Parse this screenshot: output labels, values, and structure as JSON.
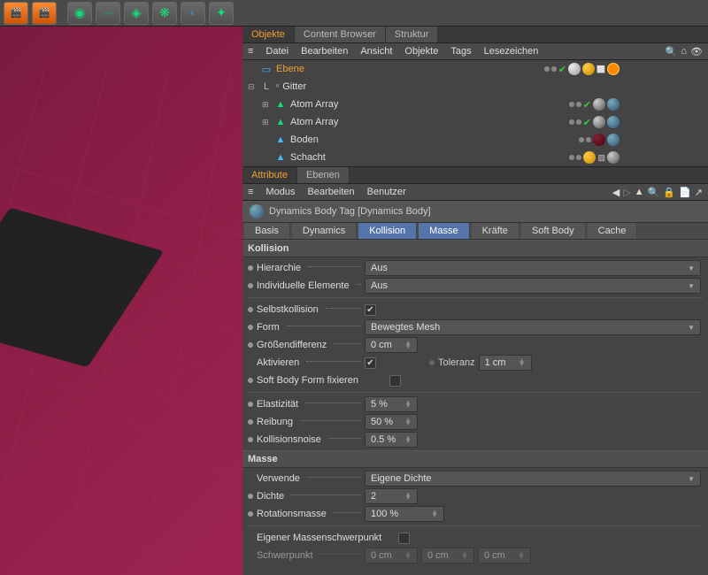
{
  "tabs": {
    "objects": "Objekte",
    "content_browser": "Content Browser",
    "struktur": "Struktur"
  },
  "menu": {
    "datei": "Datei",
    "bearbeiten": "Bearbeiten",
    "ansicht": "Ansicht",
    "objekte": "Objekte",
    "tags": "Tags",
    "lesezeichen": "Lesezeichen"
  },
  "tree": {
    "ebene": "Ebene",
    "gitter": "Gitter",
    "atom_array": "Atom Array",
    "boden": "Boden",
    "schacht": "Schacht"
  },
  "attr_tabs": {
    "attribute": "Attribute",
    "ebenen": "Ebenen"
  },
  "attr_menu": {
    "modus": "Modus",
    "bearbeiten": "Bearbeiten",
    "benutzer": "Benutzer"
  },
  "header": "Dynamics Body Tag [Dynamics Body]",
  "ptabs": {
    "basis": "Basis",
    "dynamics": "Dynamics",
    "kollision": "Kollision",
    "masse": "Masse",
    "kraefte": "Kräfte",
    "softbody": "Soft Body",
    "cache": "Cache"
  },
  "section": {
    "kollision": "Kollision",
    "masse": "Masse"
  },
  "labels": {
    "hierarchie": "Hierarchie",
    "indiv": "Individuelle Elemente",
    "selbst": "Selbstkollision",
    "form": "Form",
    "groesse": "Größendifferenz",
    "aktivieren": "Aktivieren",
    "toleranz": "Toleranz",
    "softbody": "Soft Body Form fixieren",
    "elast": "Elastizität",
    "reibung": "Reibung",
    "noise": "Kollisionsnoise",
    "verwende": "Verwende",
    "dichte": "Dichte",
    "rotmasse": "Rotationsmasse",
    "eigener": "Eigener Massenschwerpunkt",
    "schwerpunkt": "Schwerpunkt"
  },
  "values": {
    "aus": "Aus",
    "bewegtesMesh": "Bewegtes Mesh",
    "zeroCM": "0 cm",
    "oneCM": "1 cm",
    "elast": "5 %",
    "reibung": "50 %",
    "noise": "0.5 %",
    "eigeneDichte": "Eigene Dichte",
    "dichte": "2",
    "rotmasse": "100 %"
  }
}
